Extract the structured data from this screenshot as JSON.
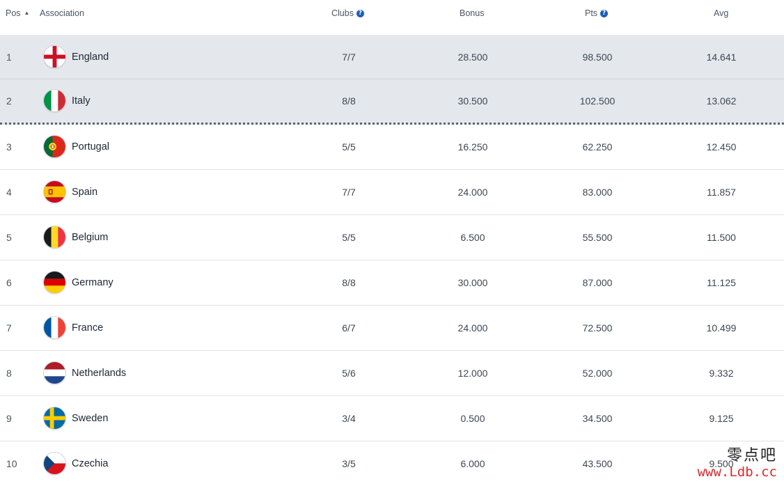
{
  "header": {
    "pos": "Pos",
    "association": "Association",
    "clubs": "Clubs",
    "bonus": "Bonus",
    "pts": "Pts",
    "avg": "Avg"
  },
  "rows": [
    {
      "pos": "1",
      "name": "England",
      "clubs": "7/7",
      "bonus": "28.500",
      "pts": "98.500",
      "avg": "14.641",
      "flag": "england-flag"
    },
    {
      "pos": "2",
      "name": "Italy",
      "clubs": "8/8",
      "bonus": "30.500",
      "pts": "102.500",
      "avg": "13.062",
      "flag": "italy-flag"
    },
    {
      "pos": "3",
      "name": "Portugal",
      "clubs": "5/5",
      "bonus": "16.250",
      "pts": "62.250",
      "avg": "12.450",
      "flag": "portugal-flag"
    },
    {
      "pos": "4",
      "name": "Spain",
      "clubs": "7/7",
      "bonus": "24.000",
      "pts": "83.000",
      "avg": "11.857",
      "flag": "spain-flag"
    },
    {
      "pos": "5",
      "name": "Belgium",
      "clubs": "5/5",
      "bonus": "6.500",
      "pts": "55.500",
      "avg": "11.500",
      "flag": "belgium-flag"
    },
    {
      "pos": "6",
      "name": "Germany",
      "clubs": "8/8",
      "bonus": "30.000",
      "pts": "87.000",
      "avg": "11.125",
      "flag": "germany-flag"
    },
    {
      "pos": "7",
      "name": "France",
      "clubs": "6/7",
      "bonus": "24.000",
      "pts": "72.500",
      "avg": "10.499",
      "flag": "france-flag"
    },
    {
      "pos": "8",
      "name": "Netherlands",
      "clubs": "5/6",
      "bonus": "12.000",
      "pts": "52.000",
      "avg": "9.332",
      "flag": "netherlands-flag"
    },
    {
      "pos": "9",
      "name": "Sweden",
      "clubs": "3/4",
      "bonus": "0.500",
      "pts": "34.500",
      "avg": "9.125",
      "flag": "sweden-flag"
    },
    {
      "pos": "10",
      "name": "Czechia",
      "clubs": "3/5",
      "bonus": "6.000",
      "pts": "43.500",
      "avg": "9.500",
      "flag": "czechia-flag"
    }
  ],
  "watermark": {
    "line1": "零点吧",
    "line2": "www.Ldb.cc"
  },
  "colors": {
    "qualified_row_bg": "#e4e8ec",
    "help_icon": "#1e5fb4",
    "watermark_url": "#e0262b"
  }
}
